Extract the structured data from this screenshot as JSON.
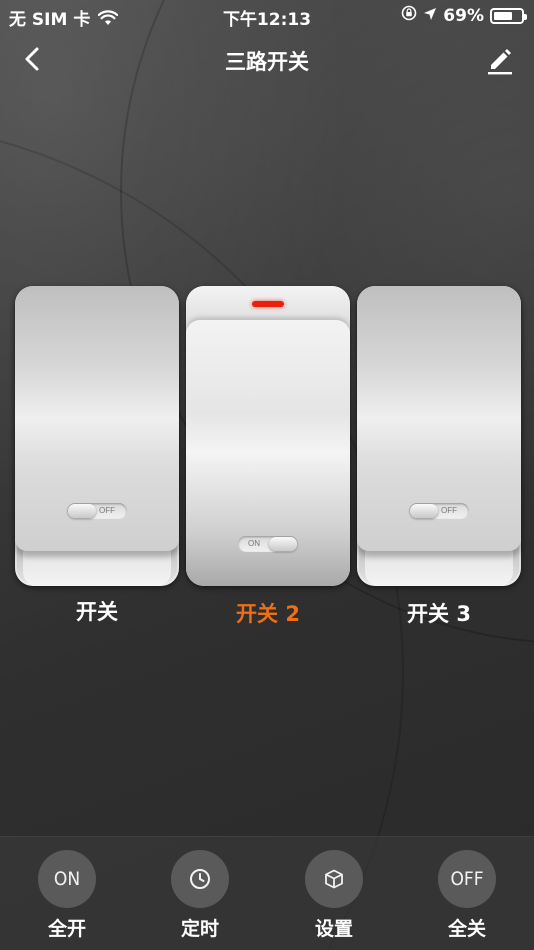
{
  "status_bar": {
    "carrier": "无 SIM 卡",
    "time": "下午12:13",
    "battery": "69%"
  },
  "nav": {
    "title": "三路开关"
  },
  "switches": [
    {
      "label": "开关",
      "state": "OFF",
      "indicator_on": false
    },
    {
      "label": "开关 2",
      "state": "ON",
      "indicator_on": true
    },
    {
      "label": "开关 3",
      "state": "OFF",
      "indicator_on": false
    }
  ],
  "actions": [
    {
      "icon_text": "ON",
      "label": "全开"
    },
    {
      "icon_name": "clock-icon",
      "label": "定时"
    },
    {
      "icon_name": "cube-icon",
      "label": "设置"
    },
    {
      "icon_text": "OFF",
      "label": "全关"
    }
  ],
  "colors": {
    "active_label": "#f06e14",
    "indicator": "#e8200e"
  }
}
